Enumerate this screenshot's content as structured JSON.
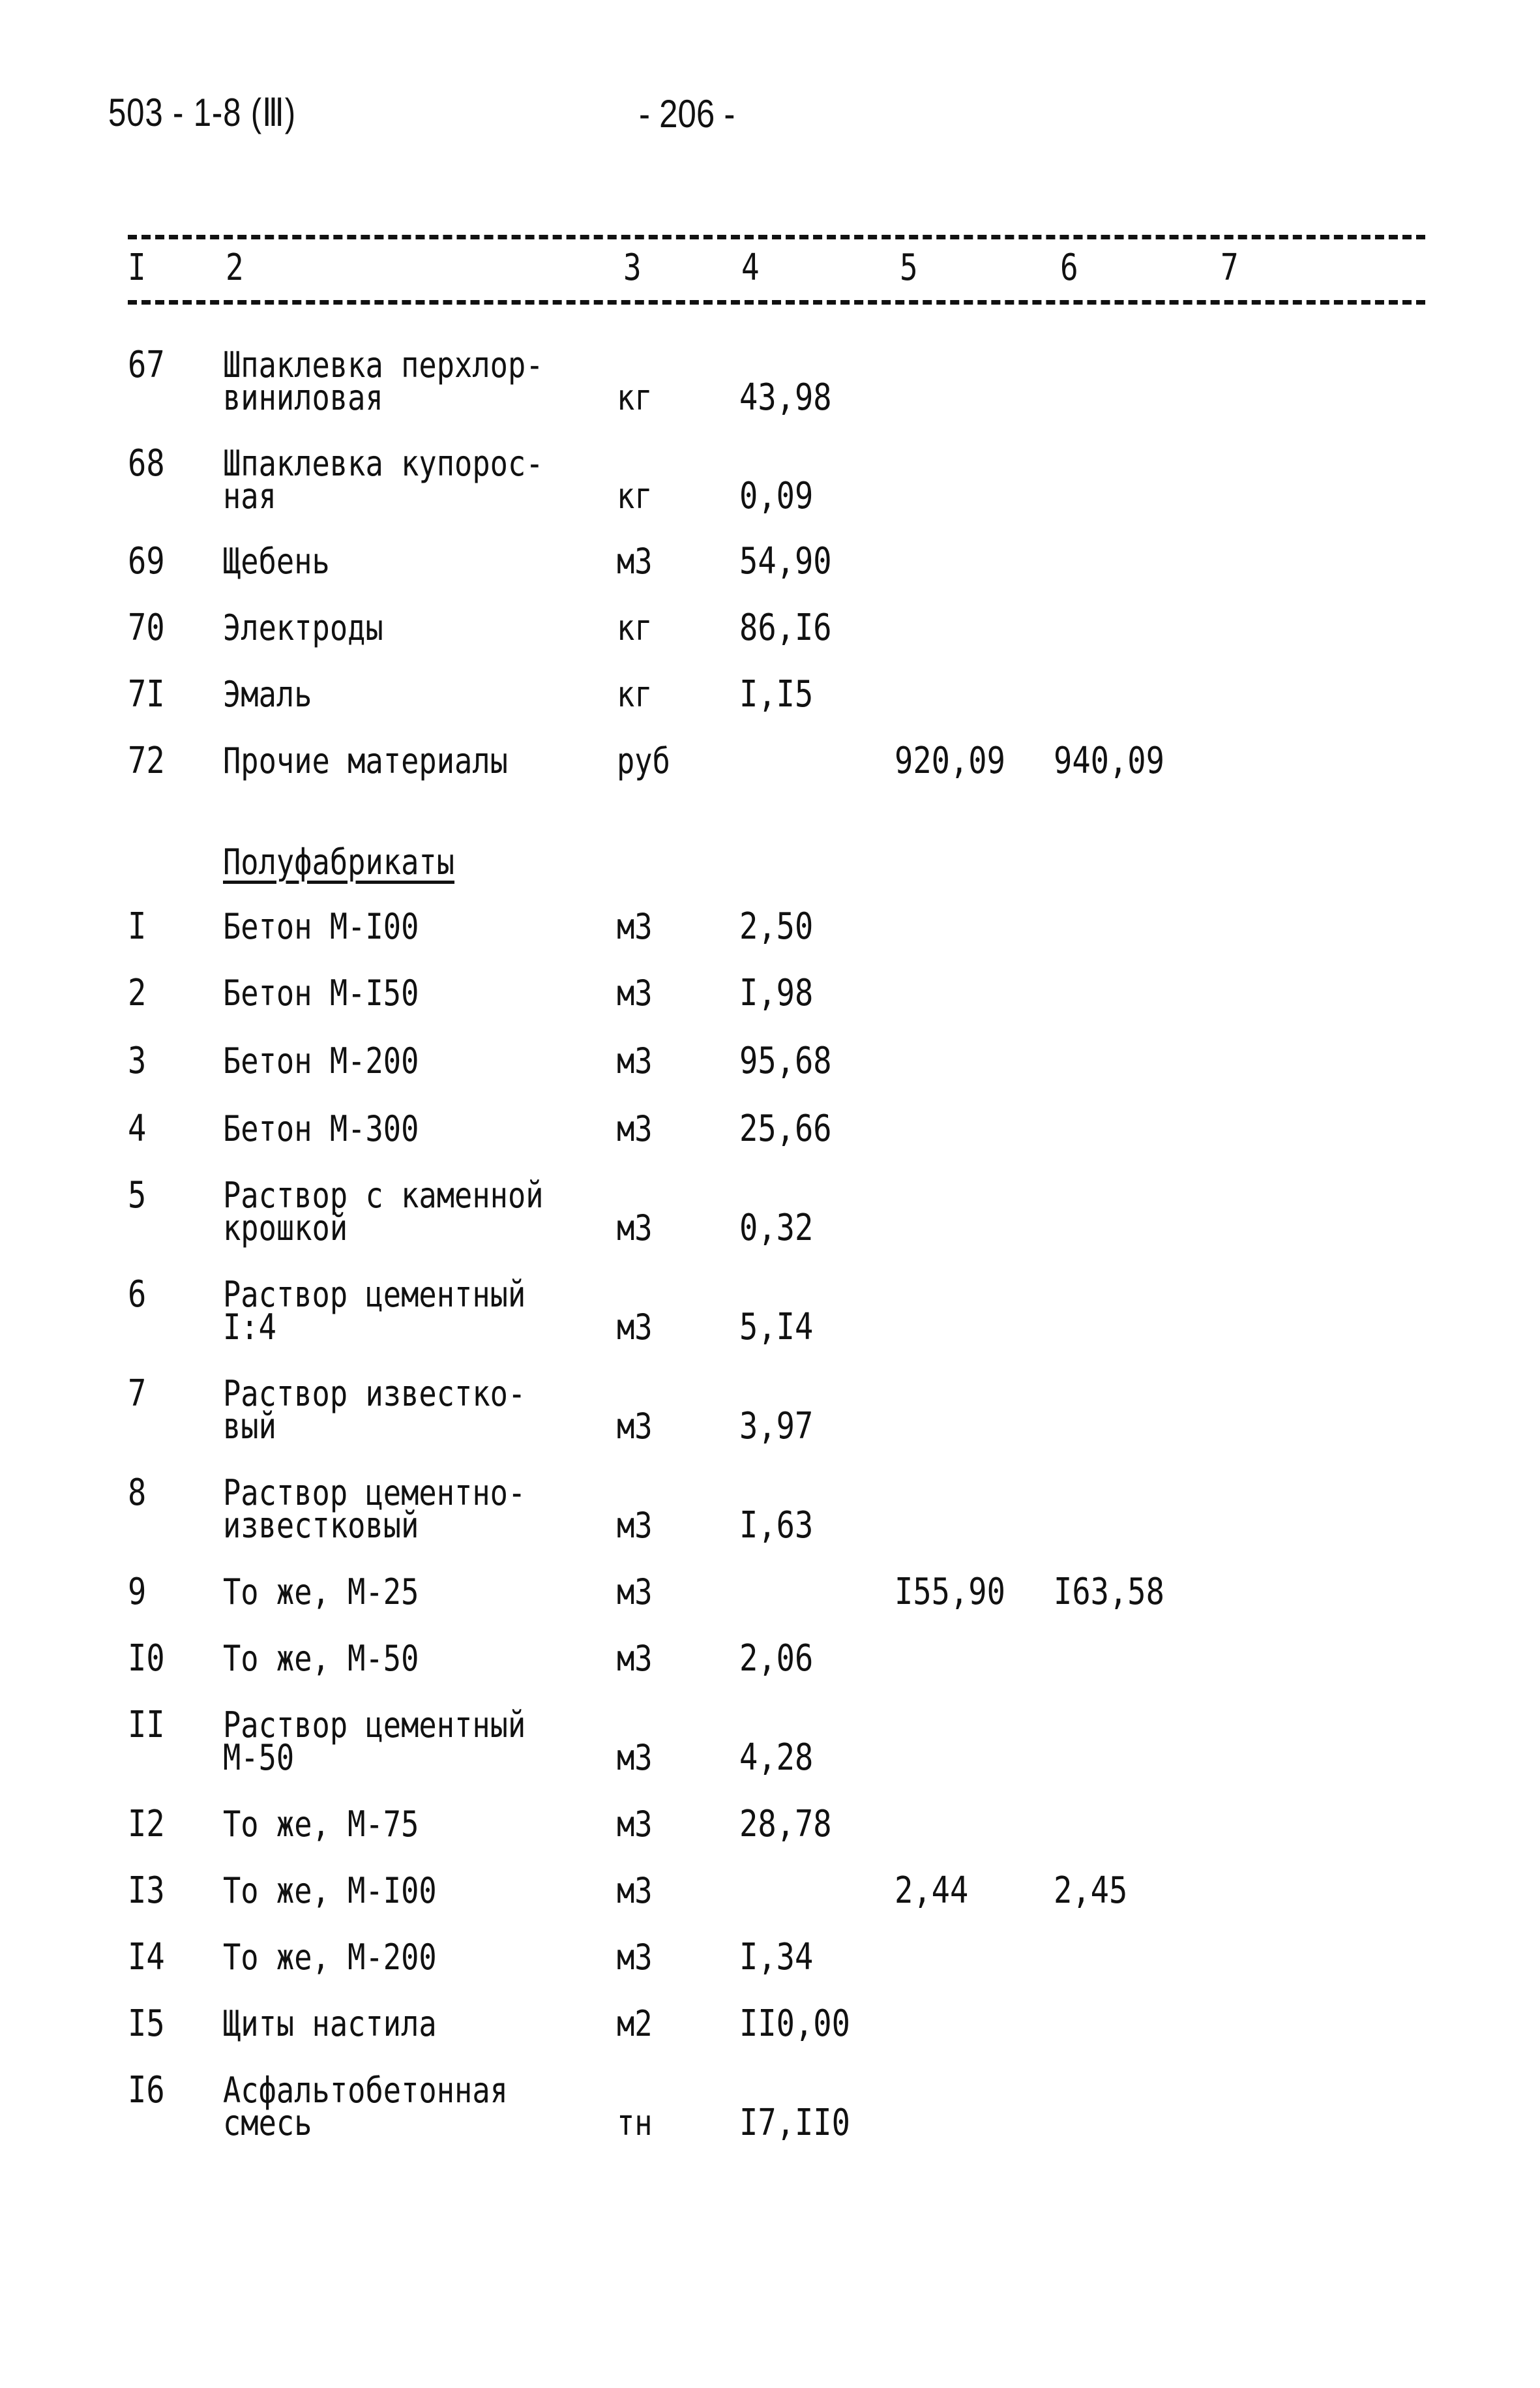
{
  "header": {
    "doc_code": "503 - 1-8 (Ⅲ)",
    "page_number": "- 206 -"
  },
  "columns": [
    "I",
    "2",
    "3",
    "4",
    "5",
    "6",
    "7"
  ],
  "section_title": "Полуфабрикаты",
  "rows_materials": [
    {
      "no": "67",
      "name": "Шпаклевка перхлор-\nвиниловая",
      "unit": "кг",
      "c4": "43,98",
      "c5": "",
      "c6": ""
    },
    {
      "no": "68",
      "name": "Шпаклевка купорос-\nная",
      "unit": "кг",
      "c4": "0,09",
      "c5": "",
      "c6": ""
    },
    {
      "no": "69",
      "name": "Щебень",
      "unit": "м3",
      "c4": "54,90",
      "c5": "",
      "c6": ""
    },
    {
      "no": "70",
      "name": "Электроды",
      "unit": "кг",
      "c4": "86,I6",
      "c5": "",
      "c6": ""
    },
    {
      "no": "7I",
      "name": "Эмаль",
      "unit": "кг",
      "c4": "I,I5",
      "c5": "",
      "c6": ""
    },
    {
      "no": "72",
      "name": "Прочие материалы",
      "unit": "руб",
      "c4": "",
      "c5": "920,09",
      "c6": "940,09"
    }
  ],
  "rows_semi": [
    {
      "no": "I",
      "name": "Бетон М-I00",
      "unit": "м3",
      "c4": "2,50",
      "c5": "",
      "c6": ""
    },
    {
      "no": "2",
      "name": "Бетон М-I50",
      "unit": "м3",
      "c4": "I,98",
      "c5": "",
      "c6": ""
    },
    {
      "no": "3",
      "name": "Бетон М-200",
      "unit": "м3",
      "c4": "95,68",
      "c5": "",
      "c6": ""
    },
    {
      "no": "4",
      "name": "Бетон М-300",
      "unit": "м3",
      "c4": "25,66",
      "c5": "",
      "c6": ""
    },
    {
      "no": "5",
      "name": "Раствор с каменной\nкрошкой",
      "unit": "м3",
      "c4": "0,32",
      "c5": "",
      "c6": ""
    },
    {
      "no": "6",
      "name": "Раствор цементный\nI:4",
      "unit": "м3",
      "c4": "5,I4",
      "c5": "",
      "c6": ""
    },
    {
      "no": "7",
      "name": "Раствор известко-\nвый",
      "unit": "м3",
      "c4": "3,97",
      "c5": "",
      "c6": ""
    },
    {
      "no": "8",
      "name": "Раствор цементно-\nизвестковый",
      "unit": "м3",
      "c4": "I,63",
      "c5": "",
      "c6": ""
    },
    {
      "no": "9",
      "name": "То же, М-25",
      "unit": "м3",
      "c4": "",
      "c5": "I55,90",
      "c6": "I63,58"
    },
    {
      "no": "I0",
      "name": "То же, М-50",
      "unit": "м3",
      "c4": "2,06",
      "c5": "",
      "c6": ""
    },
    {
      "no": "II",
      "name": "Раствор цементный\nМ-50",
      "unit": "м3",
      "c4": "4,28",
      "c5": "",
      "c6": ""
    },
    {
      "no": "I2",
      "name": "То же, М-75",
      "unit": "м3",
      "c4": "28,78",
      "c5": "",
      "c6": ""
    },
    {
      "no": "I3",
      "name": "То же, М-I00",
      "unit": "м3",
      "c4": "",
      "c5": "2,44",
      "c6": "2,45"
    },
    {
      "no": "I4",
      "name": "То же, М-200",
      "unit": "м3",
      "c4": "I,34",
      "c5": "",
      "c6": ""
    },
    {
      "no": "I5",
      "name": "Щиты настила",
      "unit": "м2",
      "c4": "II0,00",
      "c5": "",
      "c6": ""
    },
    {
      "no": "I6",
      "name": "Асфальтобетонная\nсмесь",
      "unit": "тн",
      "c4": "I7,II0",
      "c5": "",
      "c6": ""
    }
  ]
}
